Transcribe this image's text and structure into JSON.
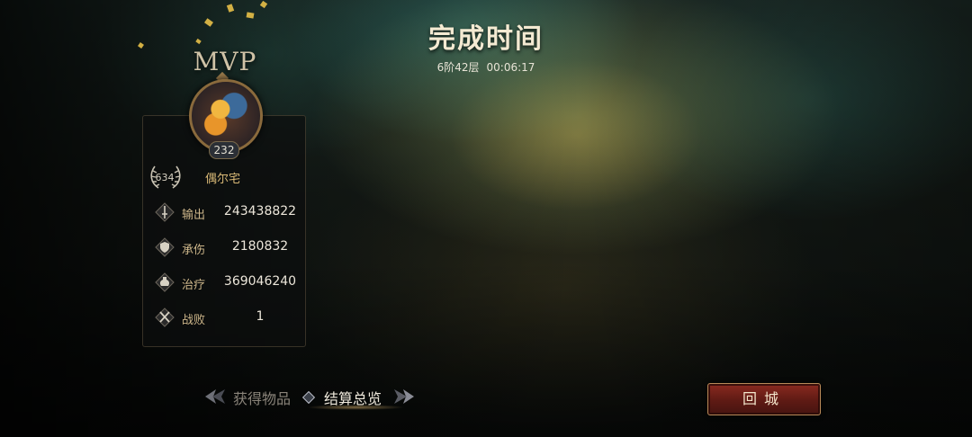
{
  "header": {
    "title": "完成时间",
    "stage": "6阶42层",
    "time": "00:06:17"
  },
  "mvp": {
    "label": "MVP",
    "level": "232",
    "rank_score": "634",
    "player_name": "偶尔宅"
  },
  "stats": [
    {
      "icon": "sword-icon",
      "label": "输出",
      "value": "243438822"
    },
    {
      "icon": "shield-icon",
      "label": "承伤",
      "value": "2180832"
    },
    {
      "icon": "potion-icon",
      "label": "治疗",
      "value": "369046240"
    },
    {
      "icon": "crossed-swords-icon",
      "label": "战败",
      "value": "1"
    }
  ],
  "tabs": {
    "items_label": "获得物品",
    "summary_label": "结算总览",
    "active": "结算总览"
  },
  "buttons": {
    "return_label": "回城"
  },
  "colors": {
    "accent_gold": "#d8b876",
    "button_red": "#8a2a20"
  }
}
